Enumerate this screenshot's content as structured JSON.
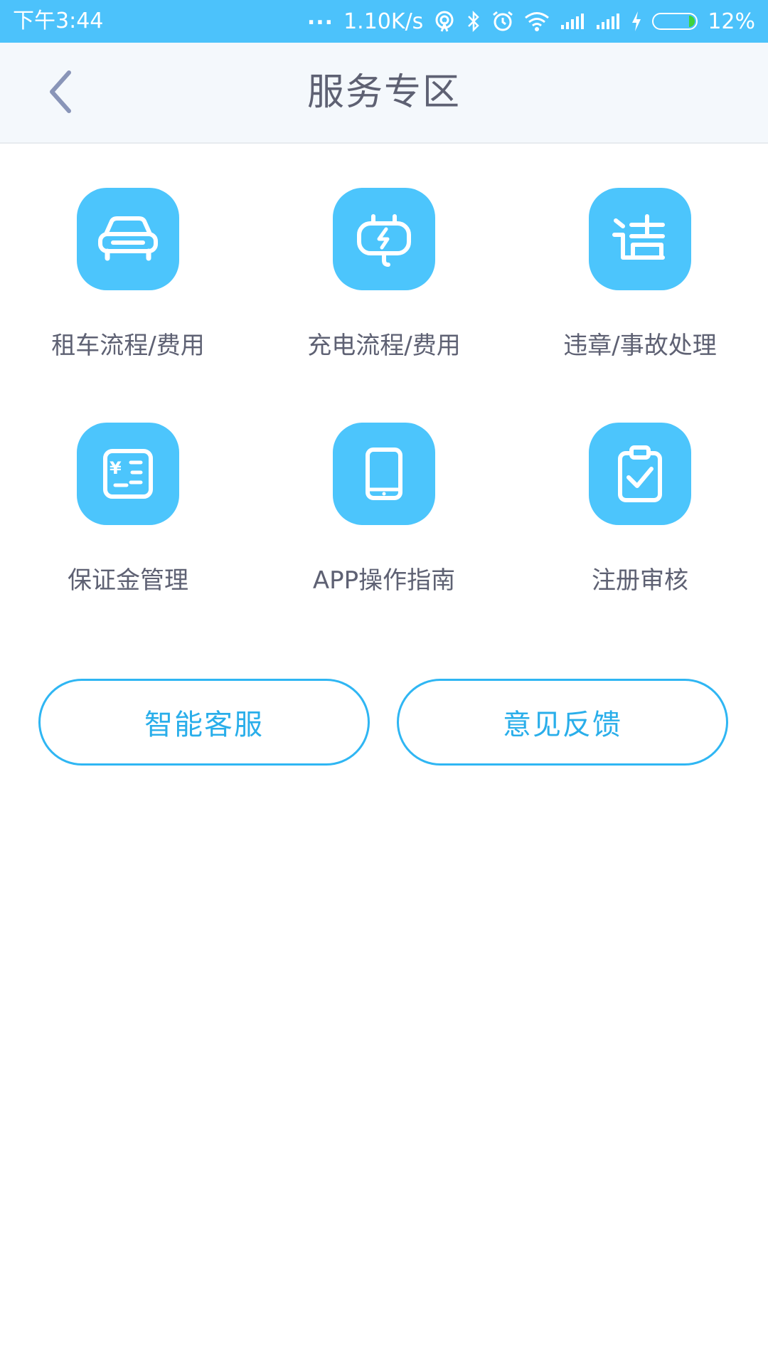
{
  "status_bar": {
    "time": "下午3:44",
    "dots": "...",
    "net_speed": "1.10K/s",
    "battery_percent": "12%",
    "battery_level": 0.12,
    "icons": [
      "hotspot-icon",
      "bluetooth-icon",
      "alarm-icon",
      "wifi-icon",
      "signal-icon",
      "signal-icon",
      "charging-icon",
      "battery-icon"
    ]
  },
  "header": {
    "title": "服务专区",
    "back_icon": "chevron-left-icon"
  },
  "services": [
    {
      "label": "租车流程/费用",
      "icon": "car-icon"
    },
    {
      "label": "充电流程/费用",
      "icon": "charger-icon"
    },
    {
      "label": "违章/事故处理",
      "icon": "violation-icon"
    },
    {
      "label": "保证金管理",
      "icon": "deposit-icon"
    },
    {
      "label": "APP操作指南",
      "icon": "tablet-icon"
    },
    {
      "label": "注册审核",
      "icon": "clipboard-check-icon"
    }
  ],
  "buttons": {
    "customer_service": "智能客服",
    "feedback": "意见反馈"
  },
  "colors": {
    "accent": "#4cc5fc",
    "status_bar": "#4cc2fb",
    "button_text": "#29aeea",
    "label_text": "#5e6173"
  }
}
